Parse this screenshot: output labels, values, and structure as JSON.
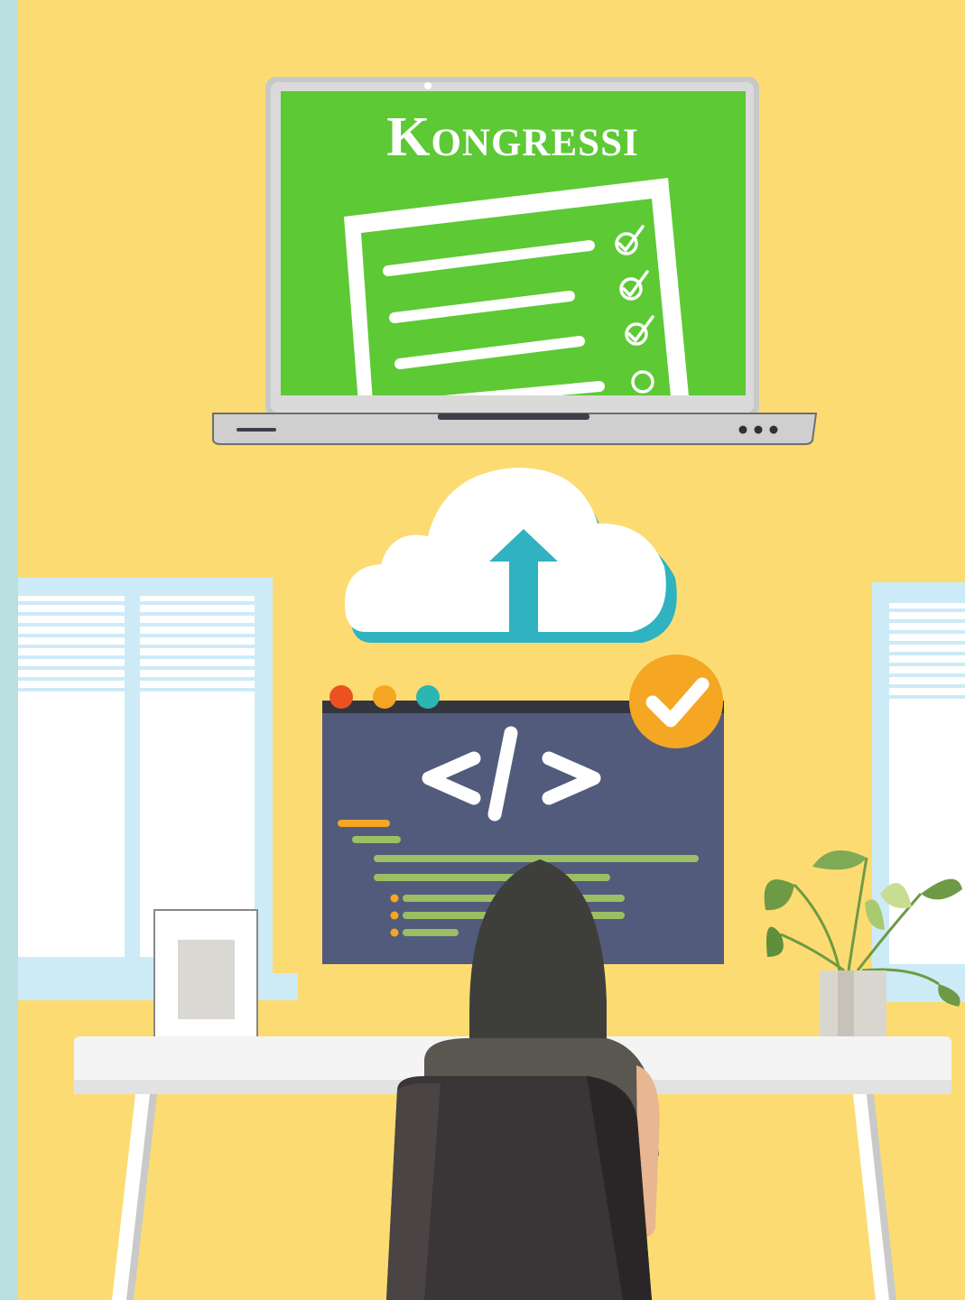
{
  "laptop": {
    "brand_title": "Kongressi"
  },
  "colors": {
    "background": "#FCDC72",
    "left_strip": "#B9DFE0",
    "laptop_screen": "#5DC935",
    "laptop_body": "#C8C8C8",
    "cloud": "#FFFFFF",
    "cloud_shadow": "#2FB3C1",
    "upload_arrow": "#30B2C0",
    "code_window": "#525B7C",
    "code_window_bar": "#33363F",
    "badge": "#F5A622",
    "dot_red": "#EE5121",
    "dot_orange": "#F5A622",
    "dot_teal": "#2BB5B3",
    "code_green": "#9DBF63",
    "code_orange": "#F5A622",
    "window_frame": "#CDEBF7",
    "desk_top": "#F4F4F4",
    "hair": "#3E3F3B",
    "chair": "#3A3536",
    "plant_leaf": "#6E9A45",
    "pot": "#D9D6CF"
  },
  "icons": {
    "upload": "cloud-upload-icon",
    "check_badge": "check-badge-icon",
    "code": "code-brackets-icon",
    "laptop_menu": "more-dots-icon"
  }
}
